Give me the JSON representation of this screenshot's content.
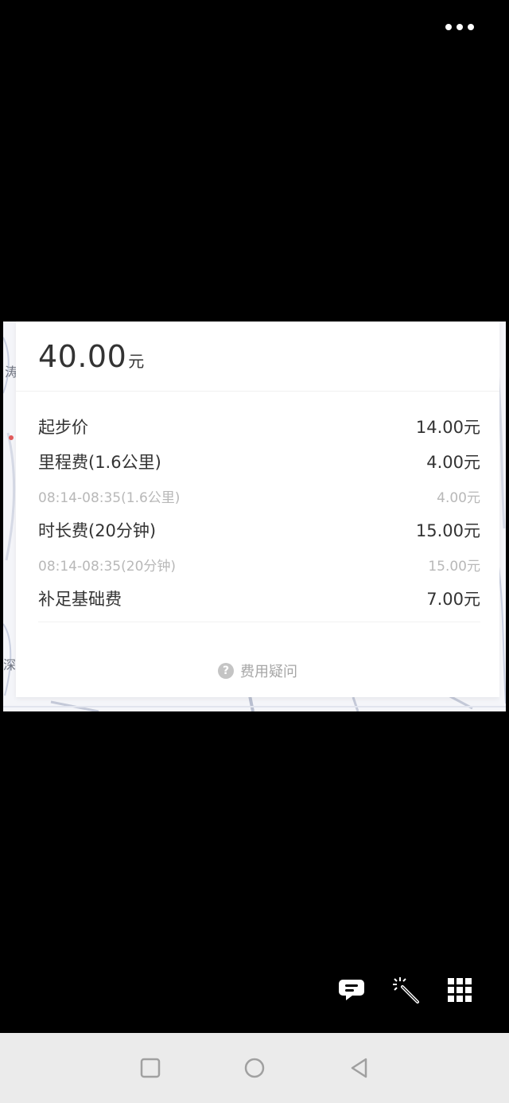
{
  "top_bar": {
    "more_icon": "more-horizontal-icon"
  },
  "fare": {
    "total_amount": "40.00",
    "total_unit": "元",
    "rows": [
      {
        "type": "main",
        "label": "起步价",
        "value": "14.00元"
      },
      {
        "type": "main",
        "label": "里程费(1.6公里)",
        "value": "4.00元"
      },
      {
        "type": "sub",
        "label": "08:14-08:35(1.6公里)",
        "value": "4.00元"
      },
      {
        "type": "main",
        "label": "时长费(20分钟)",
        "value": "15.00元"
      },
      {
        "type": "sub",
        "label": "08:14-08:35(20分钟)",
        "value": "15.00元"
      },
      {
        "type": "main",
        "label": "补足基础费",
        "value": "7.00元"
      }
    ],
    "question_label": "费用疑问",
    "question_icon": "question-circle-icon"
  },
  "map_fragments": [
    "涛",
    "深"
  ],
  "toolbar": {
    "icons": [
      "chat-bubble-icon",
      "magic-wand-icon",
      "grid-icon"
    ]
  },
  "navbar": {
    "icons": [
      "recents-square-icon",
      "home-circle-icon",
      "back-triangle-icon"
    ]
  },
  "colors": {
    "background": "#000000",
    "card": "#ffffff",
    "primary_text": "#333333",
    "secondary_text": "#b8b8b8",
    "navbar": "#ebebeb"
  }
}
